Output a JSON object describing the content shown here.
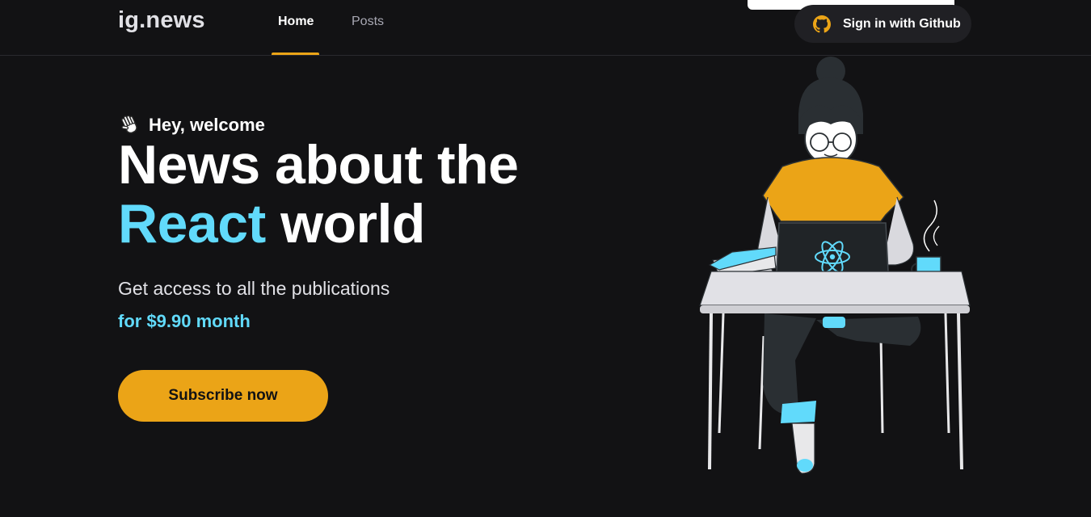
{
  "header": {
    "logo": "ig.news",
    "nav": [
      {
        "label": "Home",
        "active": true
      },
      {
        "label": "Posts",
        "active": false
      }
    ],
    "signin_label": "Sign in with Github",
    "signin_icon": "github-icon",
    "accent_color": "#eba417"
  },
  "hero": {
    "greeting": "Hey, welcome",
    "greeting_icon": "waving-hand-icon",
    "headline_line1": "News about the",
    "headline_accent": "React",
    "headline_rest": " world",
    "lead": "Get access to all the publications",
    "price": "for $9.90 month",
    "subscribe_label": "Subscribe now"
  },
  "colors": {
    "background": "#121214",
    "react_blue": "#61dafb",
    "yellow": "#eba417"
  }
}
